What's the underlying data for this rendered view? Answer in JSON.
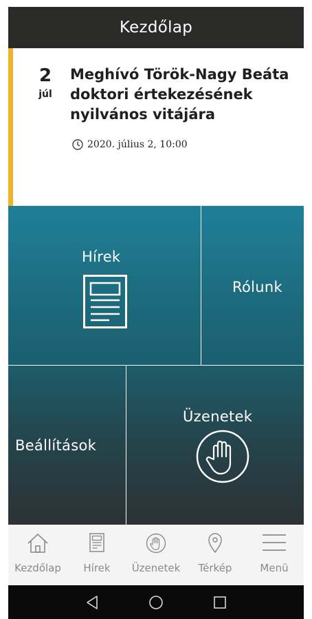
{
  "header": {
    "title": "Kezdőlap"
  },
  "event": {
    "day": "2",
    "month": "júl",
    "title": "Meghívó Török-Nagy Beáta doktori értekezésének nyilvános vitájára",
    "datetime": "2020. július 2, 10:00",
    "accent_color": "#f0b429"
  },
  "tiles": {
    "news": {
      "label": "Hírek",
      "icon": "newspaper-icon"
    },
    "about": {
      "label": "Rólunk"
    },
    "settings": {
      "label": "Beállítások"
    },
    "messages": {
      "label": "Üzenetek",
      "icon": "hand-icon"
    }
  },
  "bottom_nav": {
    "items": [
      {
        "label": "Kezdőlap",
        "icon": "home-icon"
      },
      {
        "label": "Hírek",
        "icon": "newspaper-icon"
      },
      {
        "label": "Üzenetek",
        "icon": "hand-icon"
      },
      {
        "label": "Térkép",
        "icon": "map-pin-icon"
      },
      {
        "label": "Menü",
        "icon": "menu-icon"
      }
    ]
  },
  "system_nav": {
    "buttons": [
      "back-icon",
      "home-circle-icon",
      "recents-icon"
    ]
  },
  "colors": {
    "header": "#2a2a28",
    "tile_teal": "#1f7f98",
    "tile_dark": "#2c3234",
    "nav_gray": "#8a8a8a"
  }
}
